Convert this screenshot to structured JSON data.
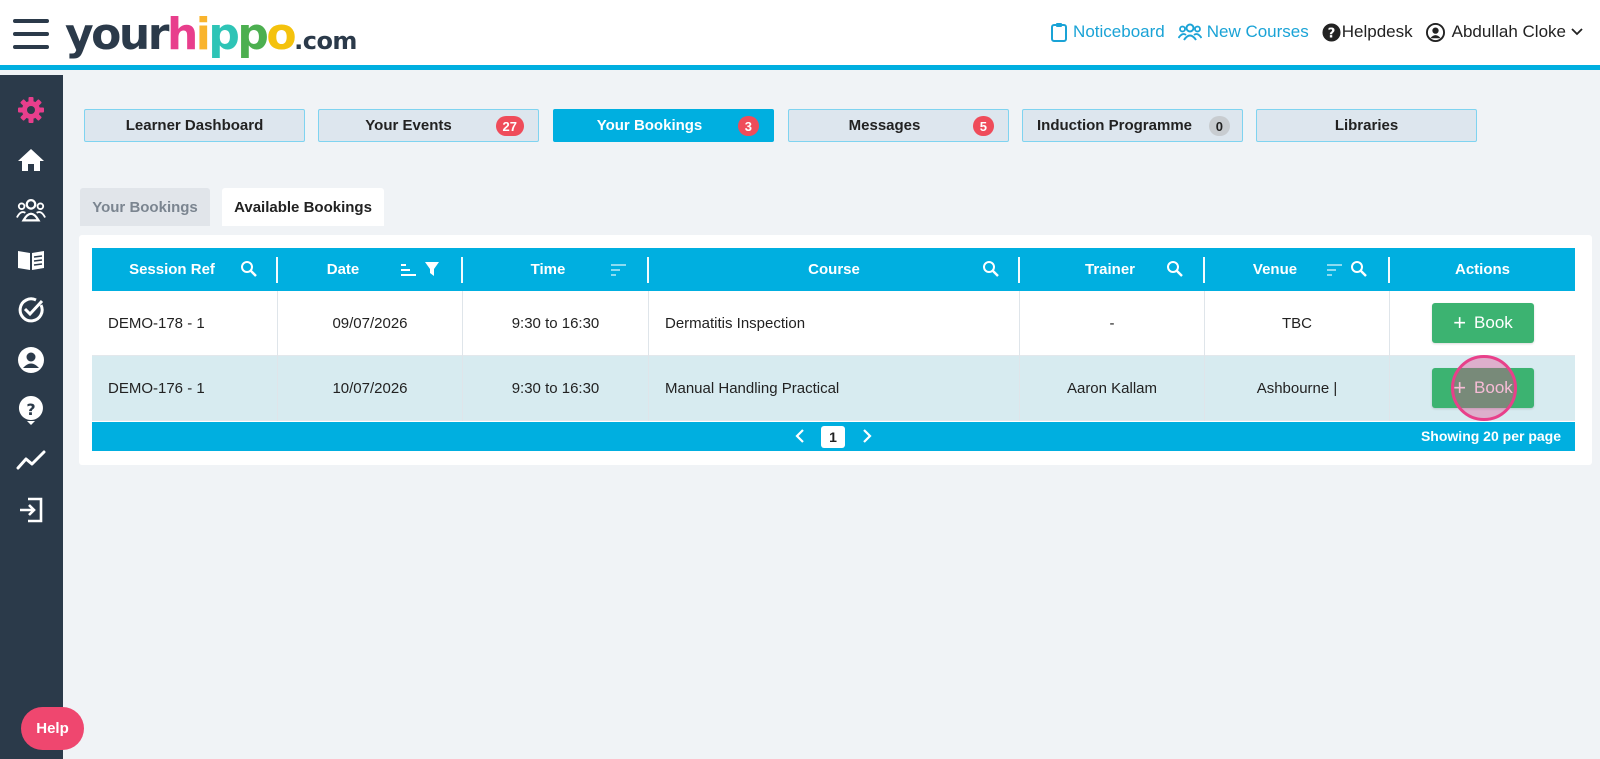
{
  "header": {
    "logo": {
      "your": "your",
      "h": "h",
      "i": "i",
      "p1": "p",
      "p2": "p",
      "o": "o",
      "com": ".com"
    },
    "nav": {
      "noticeboard": "Noticeboard",
      "new_courses": "New Courses",
      "helpdesk": "Helpdesk",
      "user": "Abdullah Cloke"
    }
  },
  "sidebar": {
    "icons": [
      "gear-icon",
      "home-icon",
      "users-icon",
      "book-icon",
      "check-circle-icon",
      "user-icon",
      "question-icon",
      "chart-icon",
      "logout-icon"
    ],
    "help_label": "Help"
  },
  "tabs": [
    {
      "label": "Learner Dashboard",
      "badge": ""
    },
    {
      "label": "Your Events",
      "badge": "27"
    },
    {
      "label": "Your Bookings",
      "badge": "3"
    },
    {
      "label": "Messages",
      "badge": "5"
    },
    {
      "label": "Induction Programme",
      "badge": "0"
    },
    {
      "label": "Libraries",
      "badge": ""
    }
  ],
  "subtabs": {
    "your_bookings": "Your Bookings",
    "available_bookings": "Available Bookings"
  },
  "table": {
    "columns": [
      "Session Ref",
      "Date",
      "Time",
      "Course",
      "Trainer",
      "Venue",
      "Actions"
    ],
    "rows": [
      {
        "ref": "DEMO-178 - 1",
        "date": "09/07/2026",
        "time": "9:30 to 16:30",
        "course": "Dermatitis Inspection",
        "trainer": "-",
        "venue": "TBC",
        "action": "Book"
      },
      {
        "ref": "DEMO-176 - 1",
        "date": "10/07/2026",
        "time": "9:30 to 16:30",
        "course": "Manual Handling Practical",
        "trainer": "Aaron Kallam",
        "venue": "Ashbourne |",
        "action": "Book"
      }
    ],
    "pagination": {
      "current_page": "1",
      "per_page_text": "Showing 20 per page"
    }
  },
  "colors": {
    "accent": "#00afe0",
    "sidebar": "#2b3a4a",
    "book": "#3cb371",
    "badge": "#ef4c5a",
    "help": "#ef476f"
  }
}
